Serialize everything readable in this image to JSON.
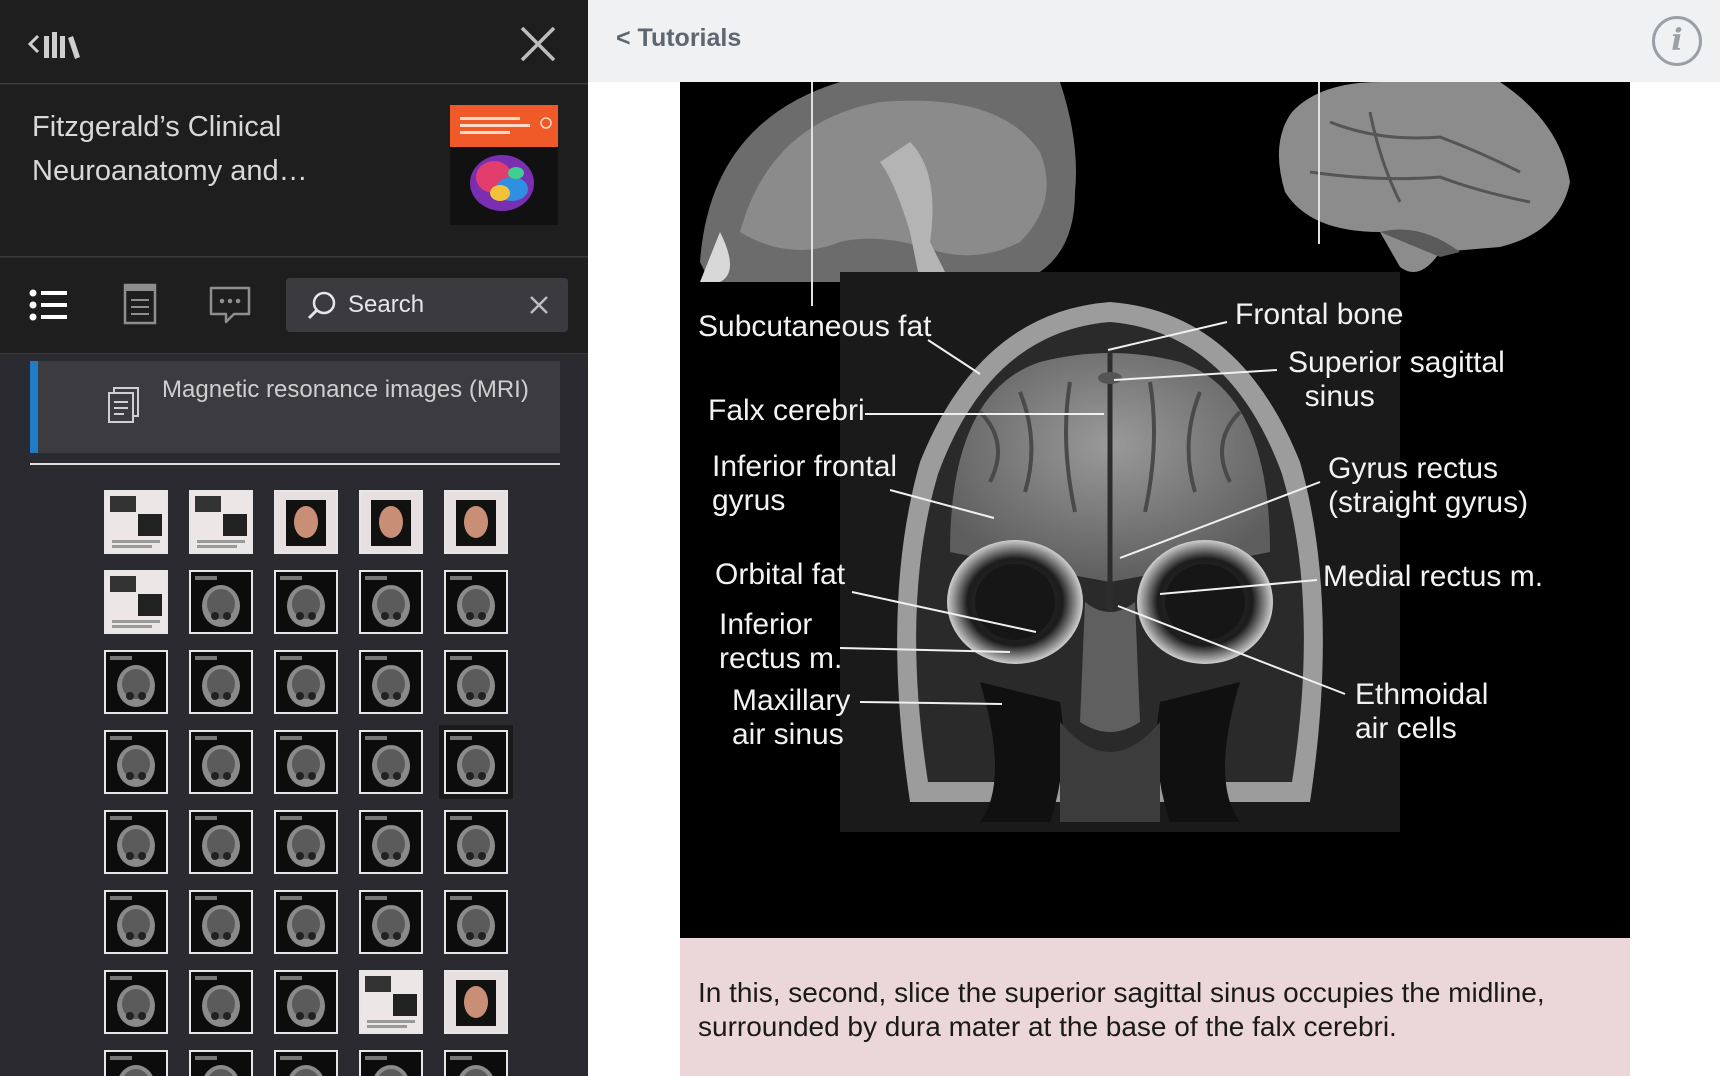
{
  "sidebar": {
    "book": {
      "title": "Fitzgerald’s Clinical Neuroanatomy and…",
      "cover_colors": {
        "top_band": "#f05a28",
        "bottom": "#111111"
      }
    },
    "search": {
      "label": "Search"
    },
    "section": {
      "label": "Magnetic resonance images (MRI)"
    },
    "thumbnails": {
      "rows": [
        [
          "page",
          "page",
          "face",
          "face",
          "face"
        ],
        [
          "page",
          "mri",
          "mri",
          "mri",
          "mri"
        ],
        [
          "mri",
          "mri",
          "mri",
          "mri",
          "mri"
        ],
        [
          "mri",
          "mri",
          "mri",
          "mri",
          "mri-selected"
        ],
        [
          "mri",
          "mri",
          "mri",
          "mri",
          "mri"
        ],
        [
          "mri",
          "mri",
          "mri",
          "mri",
          "mri"
        ],
        [
          "mri",
          "mri",
          "mri",
          "page",
          "face"
        ],
        [
          "mri",
          "mri",
          "mri",
          "mri",
          "mri"
        ]
      ]
    }
  },
  "content": {
    "back_label": "< Tutorials",
    "info_glyph": "i",
    "figure": {
      "labels": {
        "subcutaneous_fat": "Subcutaneous fat",
        "frontal_bone": "Frontal bone",
        "superior_sagittal_sinus": "Superior sagittal\n  sinus",
        "falx_cerebri": "Falx cerebri",
        "inferior_frontal_gyrus": "Inferior frontal\ngyrus",
        "gyrus_rectus": "Gyrus rectus\n(straight gyrus)",
        "orbital_fat": "Orbital fat",
        "medial_rectus": "Medial rectus m.",
        "inferior_rectus": "Inferior\nrectus m.",
        "maxillary_air_sinus": "Maxillary\nair sinus",
        "ethmoidal_air_cells": "Ethmoidal\nair cells"
      }
    },
    "caption": "In this, second, slice the superior sagittal sinus occupies the midline, surrounded by dura mater at the base of the falx cerebri."
  },
  "colors": {
    "accent": "#1e7cc8",
    "sidebar_bg": "#2b2a31",
    "caption_bg": "#ebd6d9"
  }
}
